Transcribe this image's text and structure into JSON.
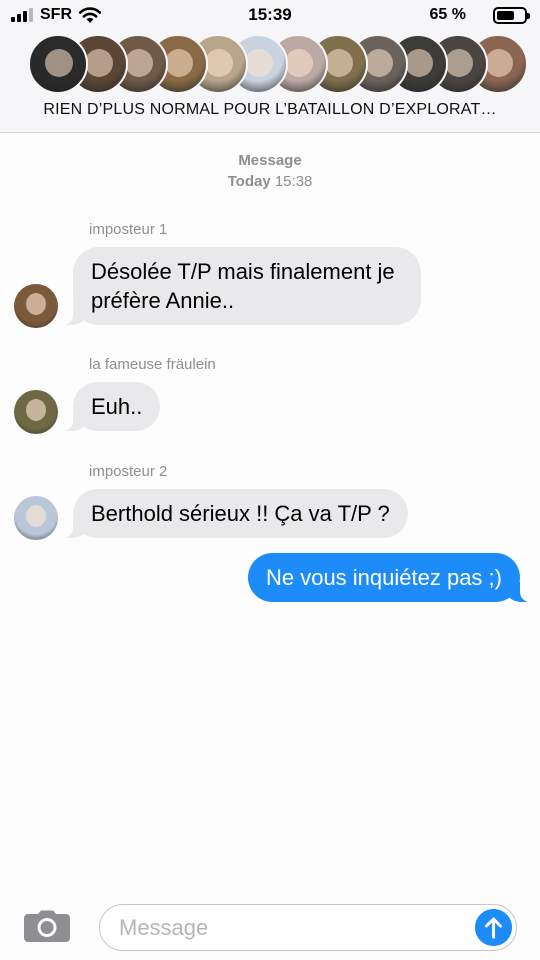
{
  "status_bar": {
    "carrier": "SFR",
    "time": "15:39",
    "battery_percent_label": "65 %",
    "battery_level": 0.65,
    "signal_bars": 3
  },
  "header": {
    "group_name": "RIEN D’PLUS NORMAL POUR L’BATAILLON D’EXPLORAT…",
    "avatar_colors": [
      "#2a2a2a",
      "#5b4636",
      "#6e5a47",
      "#8a6a46",
      "#b7a58c",
      "#c9d3e0",
      "#bda9a4",
      "#7f6f4c",
      "#6b625c",
      "#3e3c39",
      "#4a4540",
      "#8a6552"
    ]
  },
  "conversation": {
    "stamp_title": "Message",
    "stamp_day": "Today",
    "stamp_time": "15:38",
    "messages": [
      {
        "sender": "imposteur 1",
        "text": "Désolée T/P mais finalement je préfère Annie..",
        "avatar_color": "#7a5a3a"
      },
      {
        "sender": "la fameuse fräulein",
        "text": "Euh..",
        "avatar_color": "#6f6845"
      },
      {
        "sender": "imposteur 2",
        "text": "Berthold sérieux !! Ça va T/P ?",
        "avatar_color": "#b9c7d8"
      },
      {
        "text": "Ne vous inquiétez pas ;)"
      }
    ]
  },
  "input": {
    "placeholder": "Message",
    "value": ""
  },
  "colors": {
    "accent_blue": "#1d8cf8",
    "incoming_bubble": "#e9e9eb",
    "meta_gray": "#8e8e93"
  },
  "icons": [
    "signal-icon",
    "wifi-icon",
    "battery-icon",
    "camera-icon",
    "send-arrow-icon"
  ]
}
